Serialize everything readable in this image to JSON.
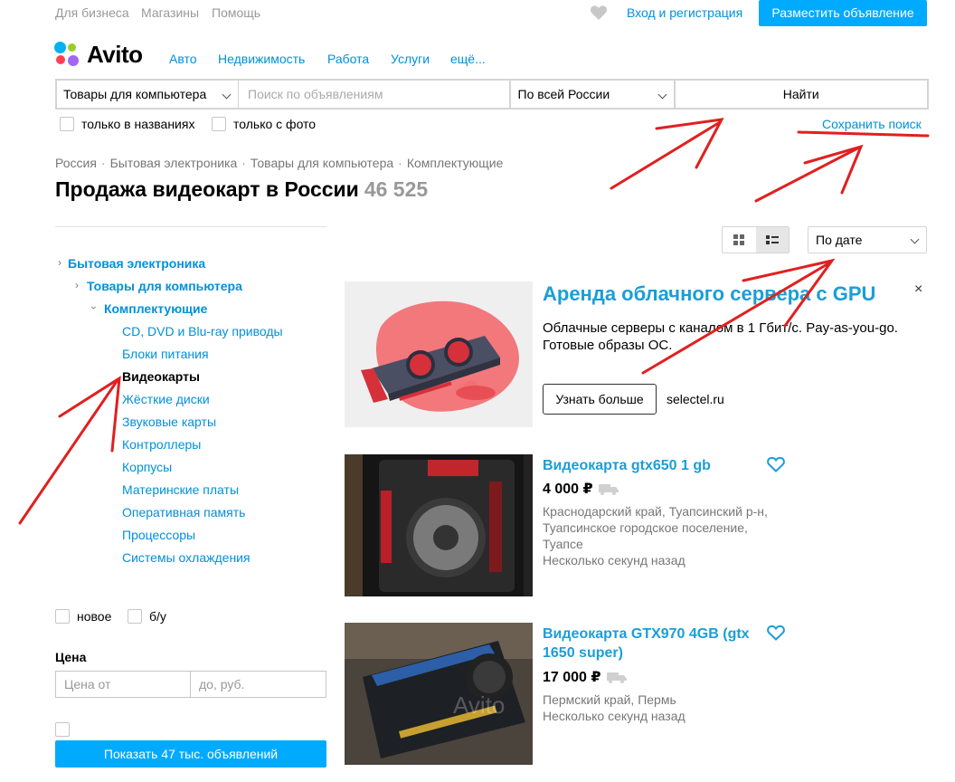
{
  "topbar": {
    "links": [
      "Для бизнеса",
      "Магазины",
      "Помощь"
    ],
    "login": "Вход и регистрация",
    "post_button": "Разместить объявление"
  },
  "header": {
    "logo_text": "Avito",
    "nav": [
      "Авто",
      "Недвижимость",
      "Работа",
      "Услуги",
      "ещё..."
    ]
  },
  "search": {
    "category": "Товары для компьютера",
    "placeholder": "Поиск по объявлениям",
    "region": "По всей России",
    "find_button": "Найти",
    "only_titles": "только в названиях",
    "only_photo": "только с фото",
    "save_search": "Сохранить поиск"
  },
  "breadcrumb": [
    "Россия",
    "Бытовая электроника",
    "Товары для компьютера",
    "Комплектующие"
  ],
  "page": {
    "title": "Продажа видеокарт в России",
    "count": "46 525"
  },
  "sidebar": {
    "level1": "Бытовая электроника",
    "level2": "Товары для компьютера",
    "level3": "Комплектующие",
    "items": [
      "CD, DVD и Blu-ray приводы",
      "Блоки питания",
      "Видеокарты",
      "Жёсткие диски",
      "Звуковые карты",
      "Контроллеры",
      "Корпусы",
      "Материнские платы",
      "Оперативная память",
      "Процессоры",
      "Системы охлаждения"
    ],
    "current": "Видеокарты",
    "condition_new": "новое",
    "condition_used": "б/у",
    "price_label": "Цена",
    "price_from_placeholder": "Цена от",
    "price_to_placeholder": "до, руб.",
    "show_button": "Показать 47 тыс. объявлений"
  },
  "sort": {
    "selected": "По дате"
  },
  "ad": {
    "title": "Аренда облачного сервера с GPU",
    "text": "Облачные серверы с каналом в 1 Гбит/с. Pay-as-you-go. Готовые образы ОС.",
    "button": "Узнать больше",
    "domain": "selectel.ru",
    "close": "×"
  },
  "listings": [
    {
      "title": "Видеокарта gtx650 1 gb",
      "price": "4 000 ₽",
      "location_lines": [
        "Краснодарский край, Туапсинский р-н,",
        "Туапсинское городское поселение,",
        "Туапсе"
      ],
      "time": "Несколько секунд назад"
    },
    {
      "title": "Видеокарта GTX970 4GB (gtx 1650 super)",
      "price": "17 000 ₽",
      "location_lines": [
        "Пермский край, Пермь"
      ],
      "time": "Несколько секунд назад"
    }
  ],
  "colors": {
    "link": "#0091d9",
    "accent": "#00aaff",
    "annotation": "#e02020"
  }
}
